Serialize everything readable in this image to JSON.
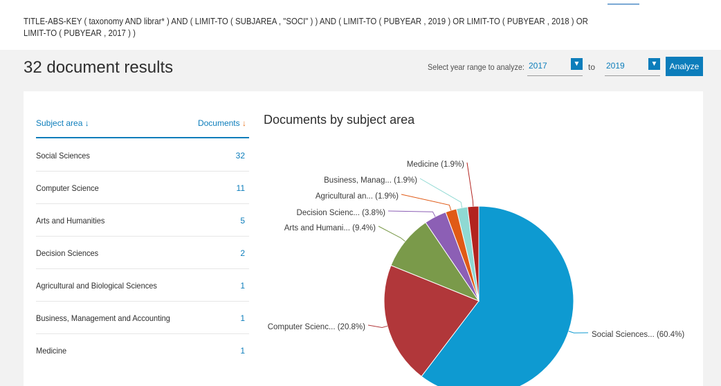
{
  "query": "TITLE-ABS-KEY ( taxonomy AND librar* ) AND ( LIMIT-TO ( SUBJAREA , \"SOCI\" ) ) AND ( LIMIT-TO ( PUBYEAR , 2019 ) OR LIMIT-TO ( PUBYEAR , 2018 ) OR LIMIT-TO ( PUBYEAR , 2017 ) )",
  "results_title": "32 document results",
  "year_range": {
    "label": "Select year range to analyze:",
    "from": "2017",
    "to_label": "to",
    "to": "2019",
    "analyze_label": "Analyze",
    "chevron": "chevron-down-icon"
  },
  "table": {
    "col_subject": "Subject area",
    "col_documents": "Documents",
    "sort_arrow": "↓",
    "rows": [
      {
        "name": "Social Sciences",
        "count": "32"
      },
      {
        "name": "Computer Science",
        "count": "11"
      },
      {
        "name": "Arts and Humanities",
        "count": "5"
      },
      {
        "name": "Decision Sciences",
        "count": "2"
      },
      {
        "name": "Agricultural and Biological Sciences",
        "count": "1"
      },
      {
        "name": "Business, Management and Accounting",
        "count": "1"
      },
      {
        "name": "Medicine",
        "count": "1"
      }
    ]
  },
  "chart_title": "Documents by subject area",
  "chart_data": {
    "type": "pie",
    "title": "Documents by subject area",
    "categories": [
      "Social Sciences",
      "Computer Science",
      "Arts and Humanities",
      "Decision Sciences",
      "Agricultural and Biological Sciences",
      "Business, Management and Accounting",
      "Medicine"
    ],
    "values": [
      60.4,
      20.8,
      9.4,
      3.8,
      1.9,
      1.9,
      1.9
    ],
    "labels": [
      "Social Sciences... (60.4%)",
      "Computer Scienc... (20.8%)",
      "Arts and Humani... (9.4%)",
      "Decision Scienc... (3.8%)",
      "Agricultural an... (1.9%)",
      "Business, Manag... (1.9%)",
      "Medicine (1.9%)"
    ],
    "colors": [
      "#0e9ad1",
      "#b1373a",
      "#7a9a4a",
      "#8c5fb5",
      "#e05a16",
      "#8fd9d3",
      "#b3231f"
    ]
  }
}
